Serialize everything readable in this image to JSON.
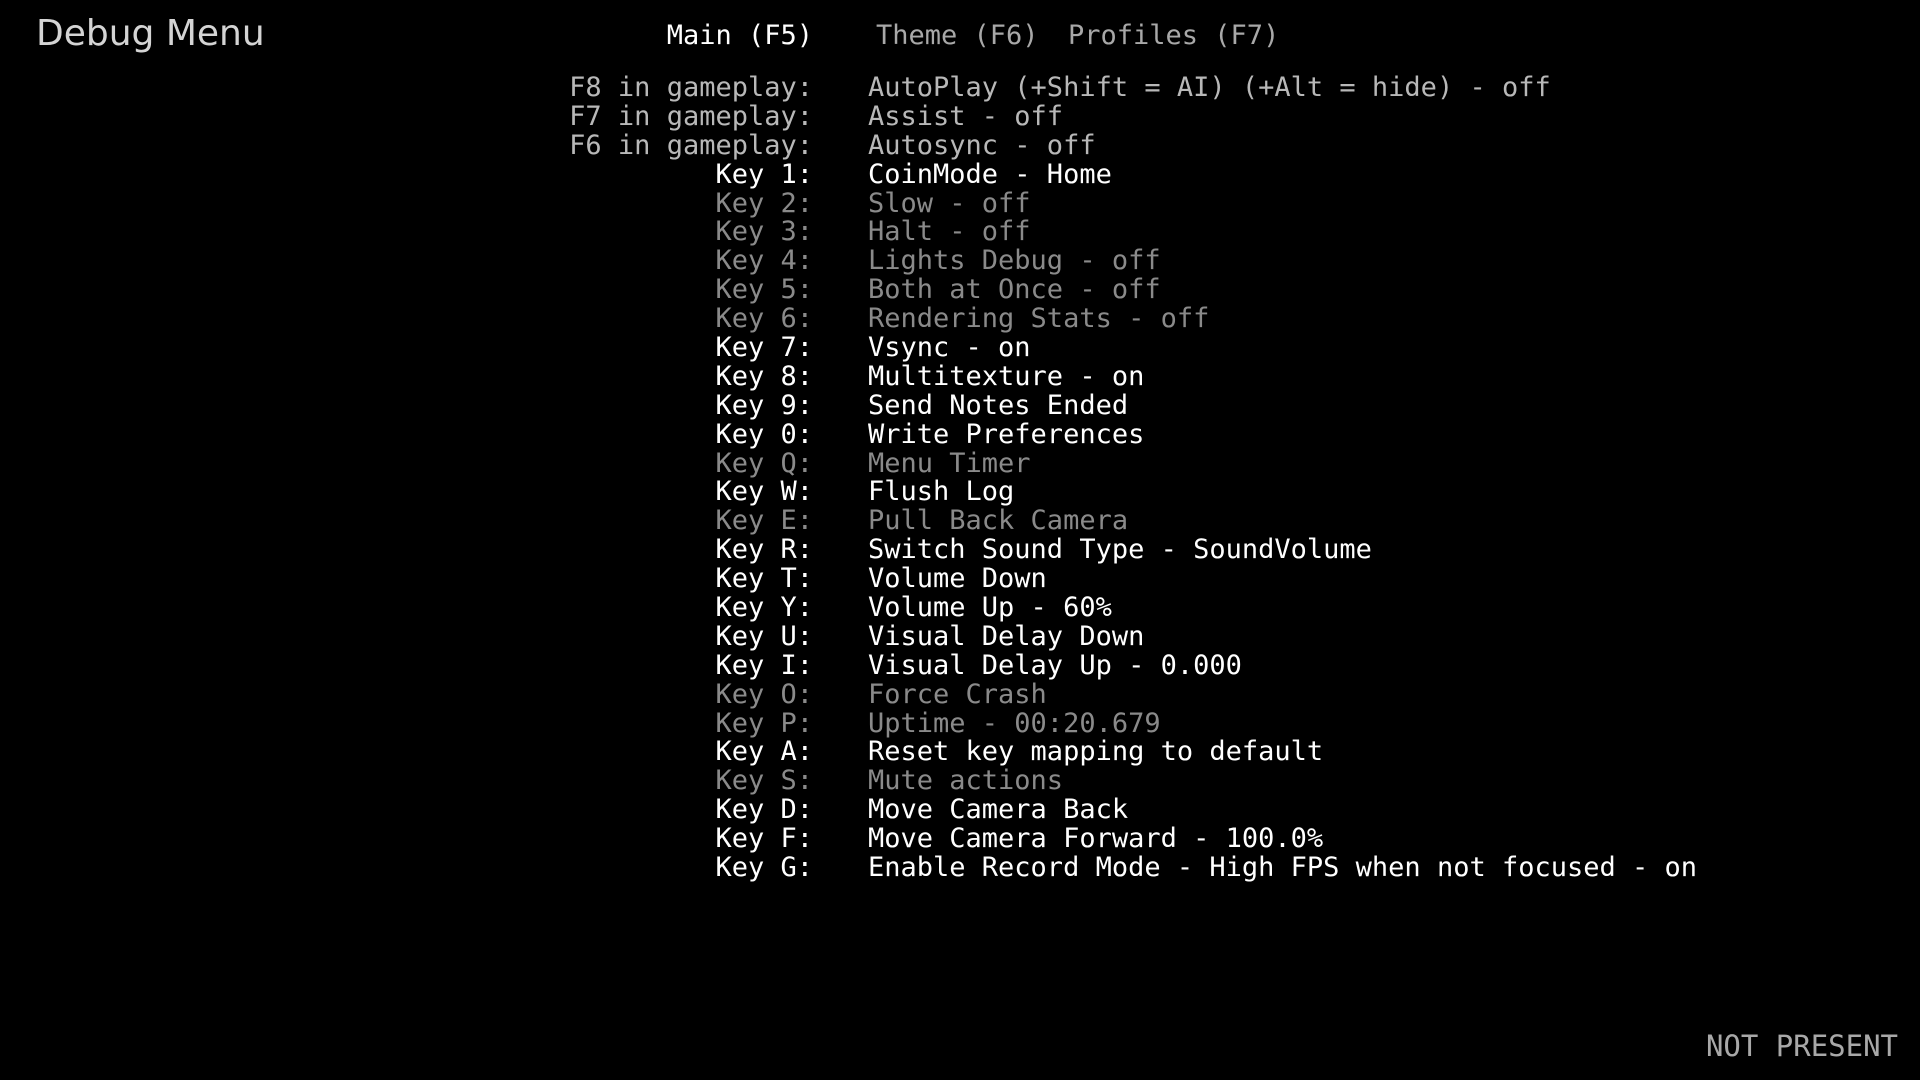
{
  "title": "Debug Menu",
  "tabs": [
    {
      "label": "Main (F5)",
      "active": true
    },
    {
      "label": "Theme (F6)",
      "active": false
    },
    {
      "label": "Profiles (F7)",
      "active": false
    }
  ],
  "rows": [
    {
      "key": "F8 in gameplay:",
      "action": "AutoPlay (+Shift = AI) (+Alt = hide) - off",
      "state": "gameplay"
    },
    {
      "key": "F7 in gameplay:",
      "action": "Assist - off",
      "state": "gameplay"
    },
    {
      "key": "F6 in gameplay:",
      "action": "Autosync - off",
      "state": "gameplay"
    },
    {
      "key": "Key 1:",
      "action": "CoinMode - Home",
      "state": "enabled"
    },
    {
      "key": "Key 2:",
      "action": "Slow - off",
      "state": "dim"
    },
    {
      "key": "Key 3:",
      "action": "Halt - off",
      "state": "dim"
    },
    {
      "key": "Key 4:",
      "action": "Lights Debug - off",
      "state": "dim"
    },
    {
      "key": "Key 5:",
      "action": "Both at Once - off",
      "state": "dim"
    },
    {
      "key": "Key 6:",
      "action": "Rendering Stats - off",
      "state": "dim"
    },
    {
      "key": "Key 7:",
      "action": "Vsync - on",
      "state": "enabled"
    },
    {
      "key": "Key 8:",
      "action": "Multitexture - on",
      "state": "enabled"
    },
    {
      "key": "Key 9:",
      "action": "Send Notes Ended",
      "state": "enabled"
    },
    {
      "key": "Key 0:",
      "action": "Write Preferences",
      "state": "enabled"
    },
    {
      "key": "Key Q:",
      "action": "Menu Timer",
      "state": "dim"
    },
    {
      "key": "Key W:",
      "action": "Flush Log",
      "state": "enabled"
    },
    {
      "key": "Key E:",
      "action": "Pull Back Camera",
      "state": "dim"
    },
    {
      "key": "Key R:",
      "action": "Switch Sound Type - SoundVolume",
      "state": "enabled"
    },
    {
      "key": "Key T:",
      "action": "Volume Down",
      "state": "enabled"
    },
    {
      "key": "Key Y:",
      "action": "Volume Up - 60%",
      "state": "enabled"
    },
    {
      "key": "Key U:",
      "action": "Visual Delay Down",
      "state": "enabled"
    },
    {
      "key": "Key I:",
      "action": "Visual Delay Up - 0.000",
      "state": "enabled"
    },
    {
      "key": "Key O:",
      "action": "Force Crash",
      "state": "dim"
    },
    {
      "key": "Key P:",
      "action": "Uptime - 00:20.679",
      "state": "dim"
    },
    {
      "key": "Key A:",
      "action": "Reset key mapping to default",
      "state": "enabled"
    },
    {
      "key": "Key S:",
      "action": "Mute actions",
      "state": "dim"
    },
    {
      "key": "Key D:",
      "action": "Move Camera Back",
      "state": "enabled"
    },
    {
      "key": "Key F:",
      "action": "Move Camera Forward - 100.0%",
      "state": "enabled"
    },
    {
      "key": "Key G:",
      "action": "Enable Record Mode - High FPS when not focused - on",
      "state": "enabled"
    }
  ],
  "status": "NOT PRESENT"
}
